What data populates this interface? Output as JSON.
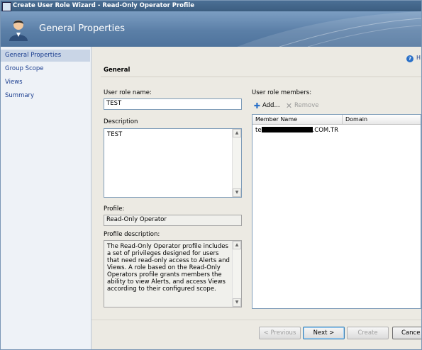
{
  "window": {
    "title": "Create User Role Wizard - Read-Only Operator Profile"
  },
  "header": {
    "title": "General Properties",
    "icon": "user-icon"
  },
  "nav": {
    "items": [
      {
        "label": "General Properties",
        "selected": true
      },
      {
        "label": "Group Scope"
      },
      {
        "label": "Views"
      },
      {
        "label": "Summary"
      }
    ]
  },
  "help": {
    "label": "H"
  },
  "section": {
    "title": "General"
  },
  "form": {
    "role_name_label": "User role name:",
    "role_name_value": "TEST",
    "description_label": "Description",
    "description_value": "TEST",
    "profile_label": "Profile:",
    "profile_value": "Read-Only Operator",
    "profile_description_label": "Profile description:",
    "profile_description_value": "The Read-Only Operator profile includes a set of privileges designed for users that need read-only access to Alerts and Views. A role based on the Read-Only Operators profile grants members the ability to view Alerts, and access Views according to their configured scope."
  },
  "members": {
    "label": "User role members:",
    "add_label": "Add...",
    "remove_label": "Remove",
    "columns": [
      "Member Name",
      "Domain"
    ],
    "rows": [
      {
        "prefix": "te",
        "suffix": ".COM.TR",
        "domain": ""
      }
    ]
  },
  "footer": {
    "previous": "< Previous",
    "next": "Next >",
    "create": "Create",
    "cancel": "Cance"
  },
  "colors": {
    "nav_link": "#1a3d8f",
    "header_bg": "#5b7fa7",
    "accent": "#2a70c8"
  }
}
